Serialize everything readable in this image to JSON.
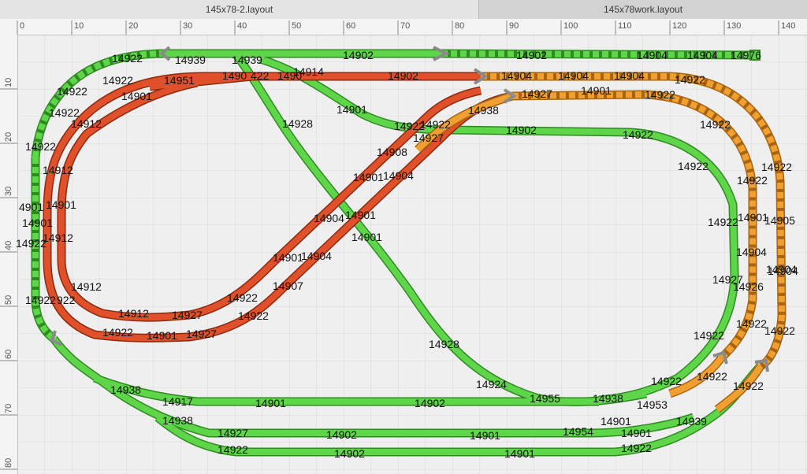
{
  "tabs": [
    {
      "label": "145x78-2.layout",
      "active": true
    },
    {
      "label": "145x78work.layout",
      "active": false
    }
  ],
  "ruler": {
    "top": [
      "0",
      "10",
      "20",
      "30",
      "40",
      "50",
      "60",
      "70",
      "80",
      "90",
      "100",
      "110",
      "120",
      "130",
      "140"
    ],
    "left": [
      "10",
      "20",
      "30",
      "40",
      "50",
      "60",
      "70",
      "80"
    ]
  },
  "colors": {
    "green": "#5fd64a",
    "green_edge": "#2f8a22",
    "red": "#e0502a",
    "red_edge": "#8a2a10",
    "orange": "#f0a030",
    "orange_edge": "#a86410",
    "switch": "#8a8a8a"
  },
  "track_labels": [
    "14922",
    "14939",
    "14939",
    "14902",
    "14902",
    "14904",
    "14904",
    "14976",
    "14922",
    "14951",
    "1490",
    "422",
    "1490",
    "14914",
    "14902",
    "14904",
    "14904",
    "14904",
    "14922",
    "14922",
    "14901",
    "14927",
    "14901",
    "14922",
    "14922",
    "14912",
    "14928",
    "14901",
    "14938",
    "14922",
    "14922",
    "14922",
    "14922",
    "14927",
    "14902",
    "14922",
    "14908",
    "14922",
    "14912",
    "14901",
    "14904",
    "14922",
    "4901",
    "14901",
    "14922",
    "14901",
    "14904",
    "14901",
    "14922",
    "14901",
    "14905",
    "14922",
    "14912",
    "14901",
    "14904",
    "14904",
    "14904",
    "14901",
    "14927",
    "14904",
    "14912",
    "14907",
    "14926",
    "14922",
    "922",
    "14922",
    "14912",
    "14927",
    "14922",
    "14922",
    "14922",
    "14922",
    "14901",
    "14927",
    "14928",
    "14922",
    "14922",
    "14924",
    "14922",
    "14922",
    "14938",
    "14955",
    "14938",
    "14953",
    "14917",
    "14901",
    "14902",
    "14938",
    "14901",
    "14939",
    "14927",
    "14902",
    "14901",
    "14954",
    "14901",
    "14922",
    "14902",
    "14901",
    "14922"
  ]
}
